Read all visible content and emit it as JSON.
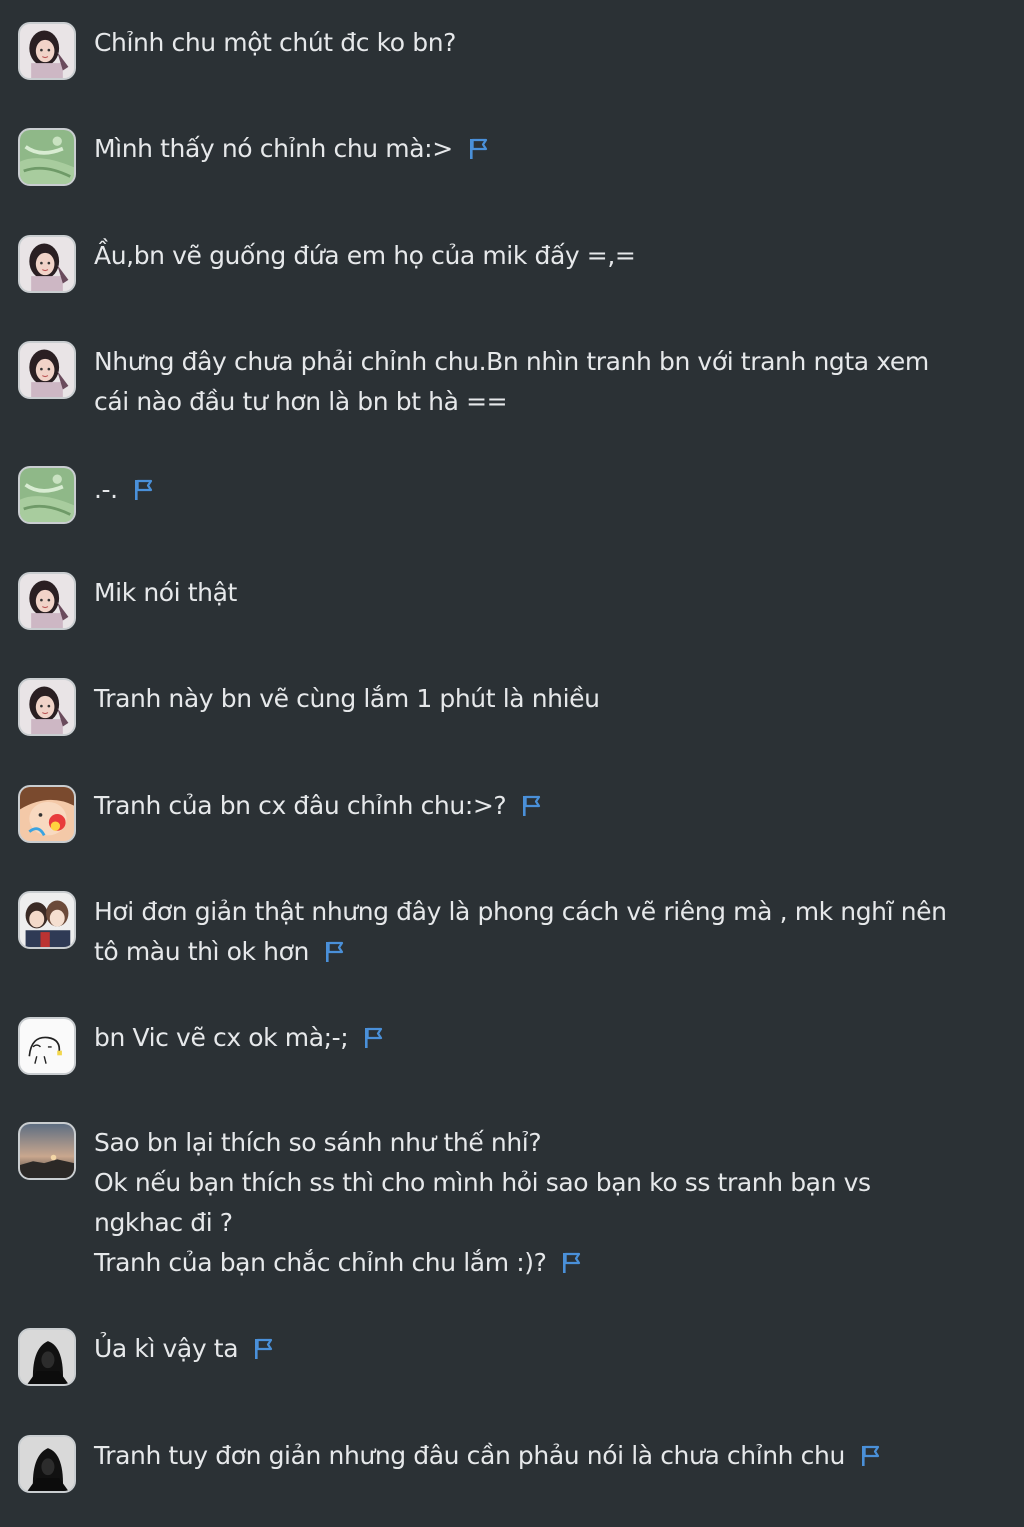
{
  "colors": {
    "background": "#2b3135",
    "text": "#e6e8ea",
    "flag": "#4a90d9"
  },
  "messages": [
    {
      "avatar": "user-girl-avatar",
      "lines": [
        "Chỉnh chu một chút đc ko bn?"
      ],
      "flag": false
    },
    {
      "avatar": "user-green-avatar",
      "lines": [
        "Mình thấy nó chỉnh chu mà:>"
      ],
      "flag": true
    },
    {
      "avatar": "user-girl-avatar",
      "lines": [
        "Ầu,bn vẽ guống đứa em họ của mik đấy =,="
      ],
      "flag": false
    },
    {
      "avatar": "user-girl-avatar",
      "lines": [
        "Nhưng đây chưa phải chỉnh chu.Bn nhìn tranh bn với tranh ngta xem",
        "cái nào đầu tư hơn là bn bt hà =="
      ],
      "flag": false
    },
    {
      "avatar": "user-green-avatar",
      "lines": [
        ".-."
      ],
      "flag": true
    },
    {
      "avatar": "user-girl-avatar",
      "lines": [
        "Mik nói thật"
      ],
      "flag": false
    },
    {
      "avatar": "user-girl-avatar",
      "lines": [
        "Tranh này bn vẽ cùng lắm 1 phút là nhiều"
      ],
      "flag": false
    },
    {
      "avatar": "user-colorful-avatar",
      "lines": [
        "Tranh của bn cx đâu chỉnh chu:>?"
      ],
      "flag": true
    },
    {
      "avatar": "user-anime-avatar",
      "lines": [
        "Hơi đơn giản thật nhưng đây là phong cách vẽ riêng mà , mk nghĩ nên",
        "tô màu thì ok hơn"
      ],
      "flag": true
    },
    {
      "avatar": "user-sketch-avatar",
      "lines": [
        "bn Vic vẽ cx ok mà;-;"
      ],
      "flag": true
    },
    {
      "avatar": "user-sunset-avatar",
      "lines": [
        "Sao bn lại thích so sánh như thế nhỉ?",
        "Ok nếu bạn thích ss thì cho mình hỏi sao bạn ko ss tranh bạn vs",
        "ngkhac đi ?",
        "Tranh của bạn chắc chỉnh chu lắm :)?"
      ],
      "flag": true
    },
    {
      "avatar": "user-dark-avatar",
      "lines": [
        "Ủa kì vậy ta"
      ],
      "flag": true
    },
    {
      "avatar": "user-dark-avatar",
      "lines": [
        "Tranh tuy đơn giản nhưng đâu cần phảu nói là chưa chỉnh chu"
      ],
      "flag": true
    }
  ]
}
